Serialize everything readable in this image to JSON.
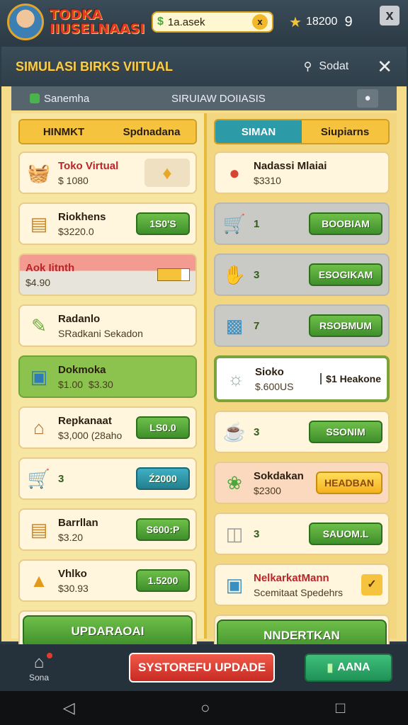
{
  "top": {
    "brand_line1": "TODKA",
    "brand_line2": "IIUSELNAASI",
    "search_text": "1a.asek",
    "clear_label": "x",
    "coins": "18200",
    "level": "9",
    "close_label": "x"
  },
  "panel": {
    "title": "SIMULASI BIRKS VIITUAL",
    "search_label": "Sodat",
    "sub_left": "Sanemha",
    "sub_right": "SIRUIAW DOIIASIS"
  },
  "left": {
    "tabs": [
      "HINMKT",
      "Spdnadana"
    ],
    "cards": [
      {
        "name": "Toko Virtual",
        "price": "$ 1080",
        "icon": "basket-icon"
      },
      {
        "name": "Riokhens",
        "price": "$3220.0",
        "button": "1S0'S",
        "icon": "ledger-icon"
      },
      {
        "name": "Aok Iitnth",
        "price": "$4.90",
        "icon": "crown-icon"
      },
      {
        "name": "Radanlo",
        "price": "SRadkani Sekadon",
        "icon": "brush-icon"
      },
      {
        "name": "Dokmoka",
        "price": "$1.00  $3.30",
        "icon": "box-icon"
      },
      {
        "name": "Repkanaat",
        "price": "$3,000 (28aho",
        "button": "LS0.0",
        "icon": "house-icon"
      },
      {
        "qty": "3",
        "button": "Ź2000",
        "icon": "cart-icon"
      },
      {
        "name": "Barrllan",
        "price": "$3.20",
        "button": "S600:P",
        "icon": "notebook-icon"
      },
      {
        "name": "Vhlko",
        "price": "$30.93",
        "button": "1.5200",
        "icon": "gold-bar-icon"
      }
    ],
    "bottom_button": "UPDARAOAI"
  },
  "right": {
    "tabs": [
      "SIMAN",
      "Siupiarns"
    ],
    "cards": [
      {
        "name": "Nadassi Mlaiai",
        "price": "$3310",
        "icon": "fruit-icon"
      },
      {
        "qty": "1",
        "button": "BOOBIAM",
        "icon": "cart-icon"
      },
      {
        "qty": "3",
        "button": "ESOGIKAM",
        "icon": "hand-icon"
      },
      {
        "qty": "7",
        "button": "RSOBMUM",
        "icon": "jar-icon"
      },
      {
        "name": "Sioko",
        "price": "$.600US",
        "extra": "$1 Heakone",
        "icon": "bag-icon"
      },
      {
        "qty": "3",
        "button": "SSONIM",
        "icon": "cup-icon"
      },
      {
        "name": "Sokdakan",
        "price": "$2300",
        "button": "HEADBAN",
        "icon": "cabbage-icon"
      },
      {
        "qty": "3",
        "button": "SAUOM.L",
        "icon": "can-icon"
      },
      {
        "name": "NelkarkatMann",
        "price": "Scemitaat Spedehrs",
        "check": "✓",
        "icon": "scanner-icon"
      }
    ],
    "bottom_button": "NNDERTKAN"
  },
  "nav": {
    "home_label": "Sona",
    "system_button": "SYSTOREFU UPDADE",
    "bank_button": "AANA"
  },
  "colors": {
    "panel": "#f4dc8a",
    "green_button": "#4f9f35",
    "teal_button": "#2d9aa8",
    "red_button": "#d93a2e"
  }
}
